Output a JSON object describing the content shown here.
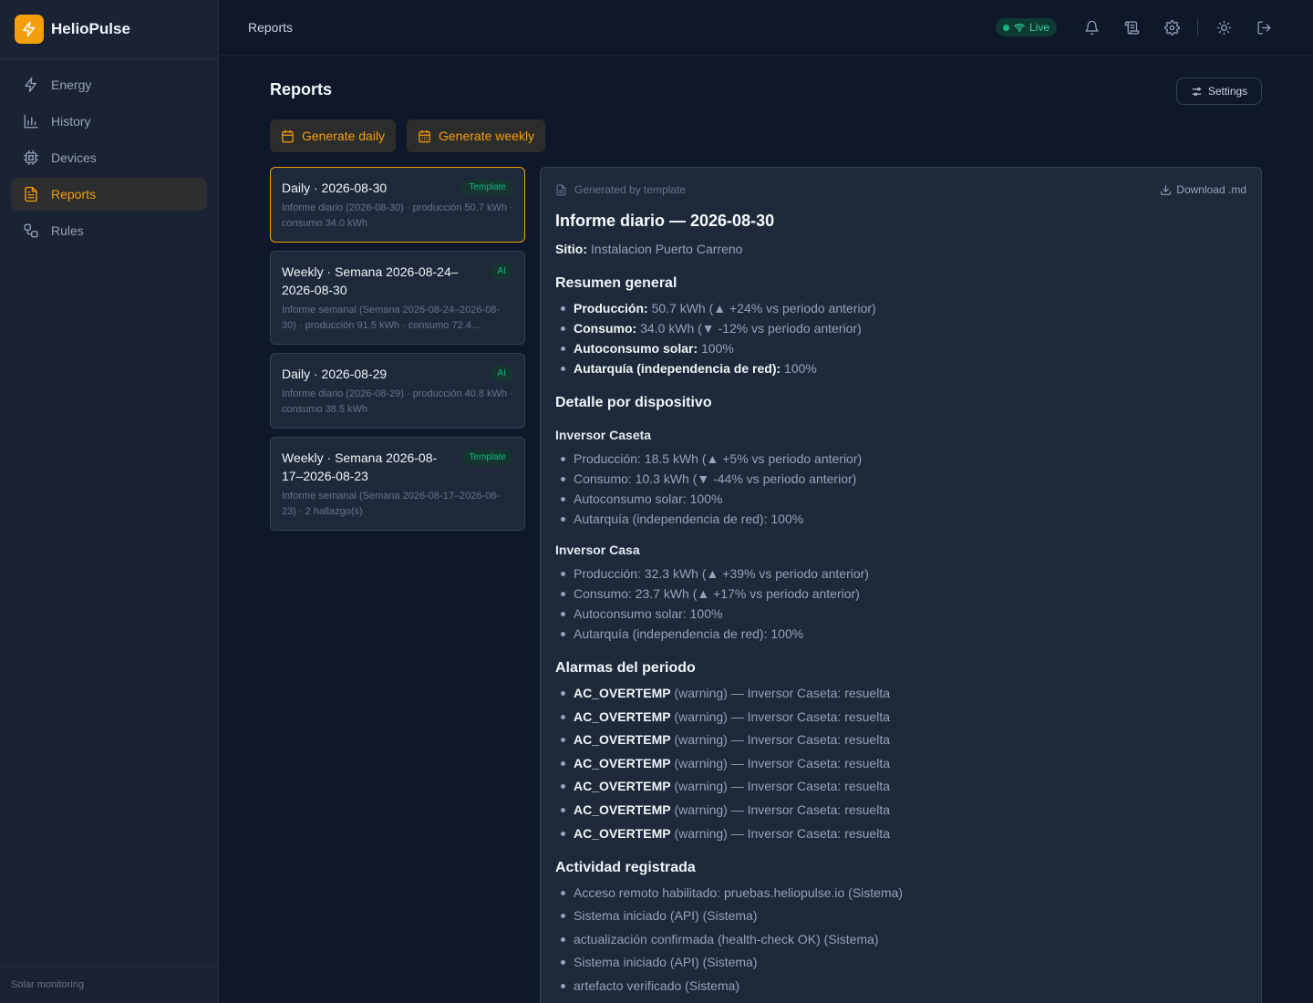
{
  "brand": {
    "name": "HelioPulse"
  },
  "sidebar": {
    "items": [
      {
        "label": "Energy",
        "icon": "bolt-icon"
      },
      {
        "label": "History",
        "icon": "bar-chart-icon"
      },
      {
        "label": "Devices",
        "icon": "chip-icon"
      },
      {
        "label": "Reports",
        "icon": "document-icon",
        "active": true
      },
      {
        "label": "Rules",
        "icon": "workflow-icon"
      }
    ],
    "footer": "Solar monitoring"
  },
  "topbar": {
    "title": "Reports",
    "live_label": "Live"
  },
  "page": {
    "title": "Reports",
    "settings_label": "Settings",
    "generate_daily_label": "Generate daily",
    "generate_weekly_label": "Generate weekly"
  },
  "reports": [
    {
      "title": "Daily · 2026-08-30",
      "badge": "Template",
      "desc": "Informe diario (2026-08-30) · producción 50.7 kWh · consumo 34.0 kWh",
      "selected": true
    },
    {
      "title": "Weekly · Semana 2026-08-24–2026-08-30",
      "badge": "AI",
      "desc": "Informe semanal (Semana 2026-08-24–2026-08-30) · producción 91.5 kWh · consumo 72.4…"
    },
    {
      "title": "Daily · 2026-08-29",
      "badge": "AI",
      "desc": "Informe diario (2026-08-29) · producción 40.8 kWh · consumo 38.5 kWh"
    },
    {
      "title": "Weekly · Semana 2026-08-17–2026-08-23",
      "badge": "Template",
      "desc": "Informe semanal (Semana 2026-08-17–2026-08-23) · 2 hallazgo(s)"
    }
  ],
  "report": {
    "generated_by": "Generated by template",
    "download_label": "Download .md",
    "title": "Informe diario — 2026-08-30",
    "site_label": "Sitio:",
    "site_value": "Instalacion Puerto Carreno",
    "summary_heading": "Resumen general",
    "summary": [
      {
        "label": "Producción:",
        "value": "50.7 kWh (▲ +24% vs periodo anterior)"
      },
      {
        "label": "Consumo:",
        "value": "34.0 kWh (▼ -12% vs periodo anterior)"
      },
      {
        "label": "Autoconsumo solar:",
        "value": "100%"
      },
      {
        "label": "Autarquía (independencia de red):",
        "value": "100%"
      }
    ],
    "detail_heading": "Detalle por dispositivo",
    "devices": [
      {
        "name": "Inversor Caseta",
        "lines": [
          "Producción: 18.5 kWh (▲ +5% vs periodo anterior)",
          "Consumo: 10.3 kWh (▼ -44% vs periodo anterior)",
          "Autoconsumo solar: 100%",
          "Autarquía (independencia de red): 100%"
        ]
      },
      {
        "name": "Inversor Casa",
        "lines": [
          "Producción: 32.3 kWh (▲ +39% vs periodo anterior)",
          "Consumo: 23.7 kWh (▲ +17% vs periodo anterior)",
          "Autoconsumo solar: 100%",
          "Autarquía (independencia de red): 100%"
        ]
      }
    ],
    "alarms_heading": "Alarmas del periodo",
    "alarms": [
      {
        "code": "AC_OVERTEMP",
        "text": "(warning) — Inversor Caseta: resuelta"
      },
      {
        "code": "AC_OVERTEMP",
        "text": "(warning) — Inversor Caseta: resuelta"
      },
      {
        "code": "AC_OVERTEMP",
        "text": "(warning) — Inversor Caseta: resuelta"
      },
      {
        "code": "AC_OVERTEMP",
        "text": "(warning) — Inversor Caseta: resuelta"
      },
      {
        "code": "AC_OVERTEMP",
        "text": "(warning) — Inversor Caseta: resuelta"
      },
      {
        "code": "AC_OVERTEMP",
        "text": "(warning) — Inversor Caseta: resuelta"
      },
      {
        "code": "AC_OVERTEMP",
        "text": "(warning) — Inversor Caseta: resuelta"
      }
    ],
    "activity_heading": "Actividad registrada",
    "activity": [
      "Acceso remoto habilitado: pruebas.heliopulse.io (Sistema)",
      "Sistema iniciado (API) (Sistema)",
      "actualización confirmada (health-check OK) (Sistema)",
      "Sistema iniciado (API) (Sistema)",
      "artefacto verificado (Sistema)"
    ]
  },
  "colors": {
    "accent": "#f59e0b",
    "live": "#10b981",
    "background": "#0f172a",
    "panel": "#1e293b"
  }
}
